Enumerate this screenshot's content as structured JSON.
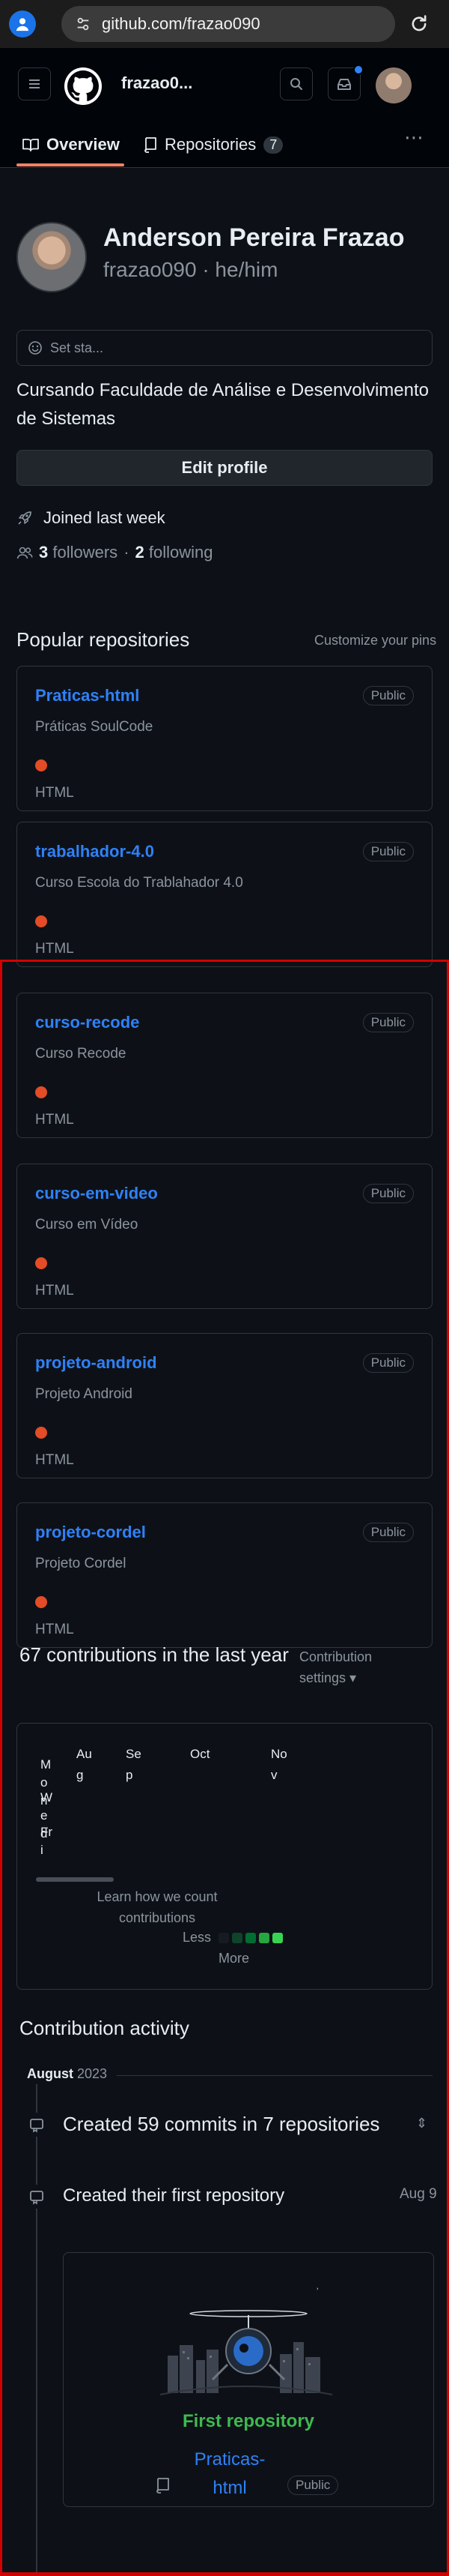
{
  "browser": {
    "url": "github.com/frazao090"
  },
  "header": {
    "username": "frazao0..."
  },
  "tabs": [
    {
      "label": "Overview",
      "selected": true
    },
    {
      "label": "Repositories",
      "count": "7"
    }
  ],
  "profile": {
    "name": "Anderson Pereira Frazao",
    "login": "frazao090 · he/him",
    "status_placeholder": "Set sta...",
    "bio": "Cursando Faculdade de Análise e Desenvolvimento de Sistemas",
    "edit_label": "Edit profile",
    "joined": "Joined last week",
    "followers_count": "3",
    "followers_label": "followers",
    "following_sep": "·",
    "following_count": "2",
    "following_label": "following"
  },
  "popular": {
    "title": "Popular repositories",
    "customize": "Customize your pins",
    "repos": [
      {
        "name": "Praticas-html",
        "visibility": "Public",
        "description": "Práticas SoulCode",
        "language": "HTML",
        "language_color": "#e34c26"
      },
      {
        "name": "trabalhador-4.0",
        "visibility": "Public",
        "description": "Curso Escola do Trablahador 4.0",
        "language": "HTML",
        "language_color": "#e34c26"
      },
      {
        "name": "curso-recode",
        "visibility": "Public",
        "description": "Curso Recode",
        "language": "HTML",
        "language_color": "#e34c26"
      },
      {
        "name": "curso-em-video",
        "visibility": "Public",
        "description": "Curso em Vídeo",
        "language": "HTML",
        "language_color": "#e34c26"
      },
      {
        "name": "projeto-android",
        "visibility": "Public",
        "description": "Projeto Android",
        "language": "HTML",
        "language_color": "#e34c26"
      },
      {
        "name": "projeto-cordel",
        "visibility": "Public",
        "description": "Projeto Cordel",
        "language": "HTML",
        "language_color": "#e34c26"
      }
    ]
  },
  "contributions": {
    "title": "67 contributions in the last year",
    "settings": "Contribution settings ▾",
    "months": [
      "Aug",
      "Sep",
      "Oct",
      "Nov"
    ],
    "days": [
      "Mon",
      "Wed",
      "Fri"
    ],
    "learn": "Learn how we count contributions",
    "less": "Less",
    "more": "More",
    "legend_colors": [
      "#161b22",
      "#0e4429",
      "#006d32",
      "#26a641",
      "#39d353"
    ]
  },
  "activity": {
    "title": "Contribution activity",
    "month": "August",
    "year": "2023",
    "commits": "Created 59 commits in 7 repositories",
    "first_repo": "Created their first repository",
    "first_repo_date": "Aug 9",
    "first_repo_title": "First repository",
    "first_repo_name": "Praticas-html",
    "first_repo_visibility": "Public"
  }
}
